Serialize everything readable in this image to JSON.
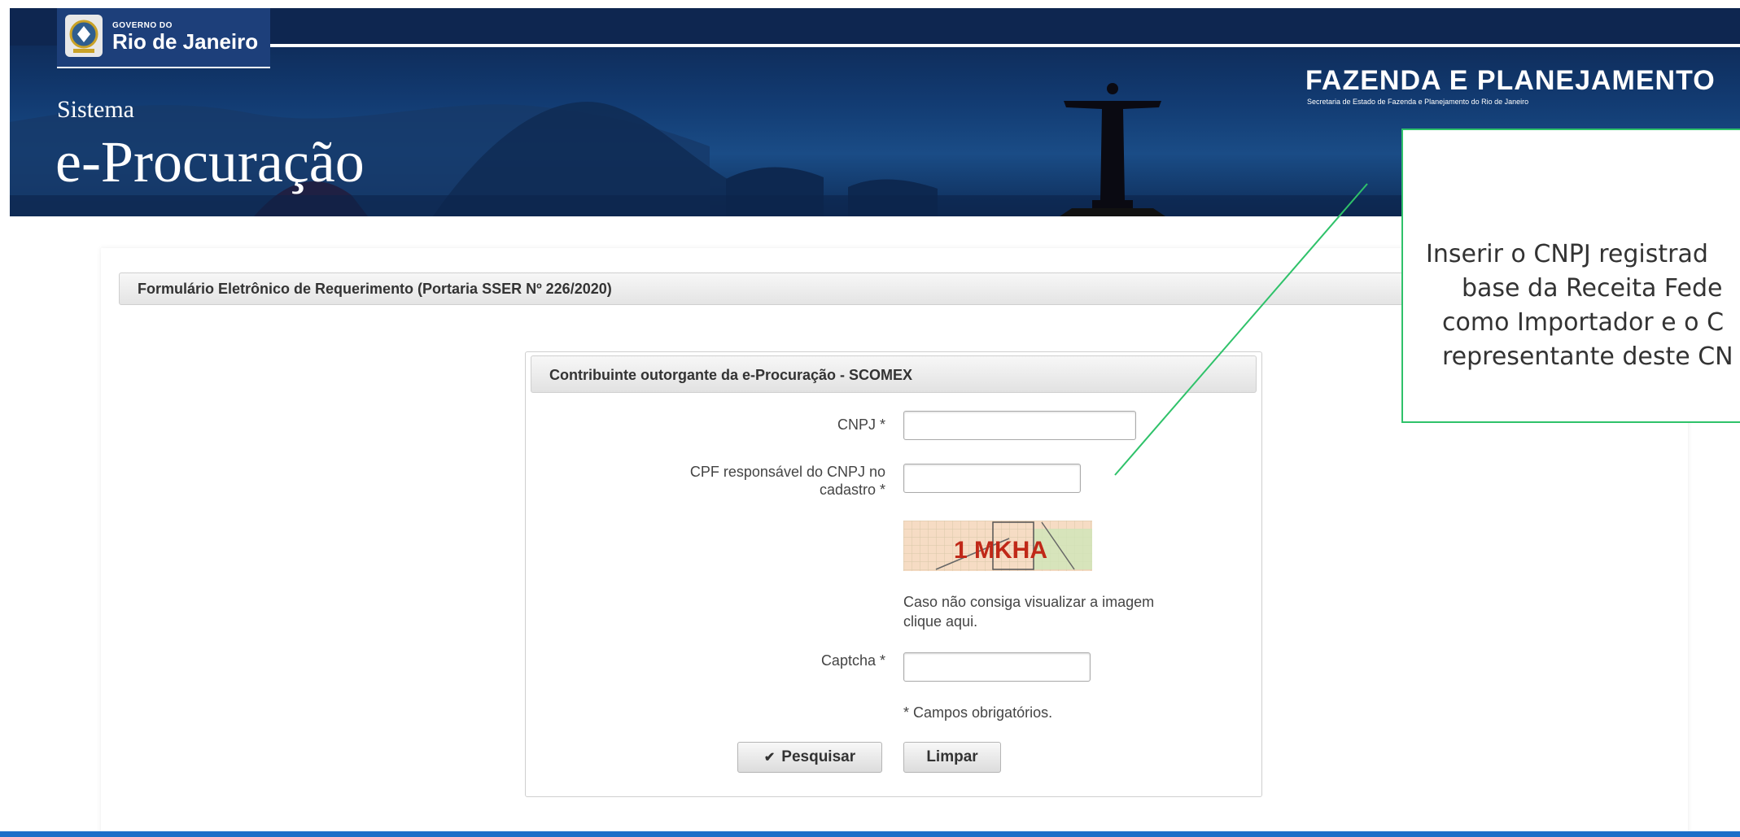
{
  "header": {
    "gov_small": "GOVERNO DO",
    "gov_name": "Rio de Janeiro",
    "system_label": "Sistema",
    "system_name": "e-Procuração",
    "org_title": "FAZENDA E PLANEJAMENTO",
    "org_subtitle": "Secretaria de Estado de Fazenda e Planejamento do Rio de Janeiro"
  },
  "page": {
    "outer_title": "Formulário Eletrônico de Requerimento (Portaria SSER Nº 226/2020)"
  },
  "form": {
    "title": "Contribuinte outorgante da e-Procuração - SCOMEX",
    "cnpj_label": "CNPJ *",
    "cnpj_value": "",
    "cpf_label_line1": "CPF responsável do CNPJ no",
    "cpf_label_line2": "cadastro *",
    "cpf_value": "",
    "captcha_text": "1 MKHA",
    "captcha_hint_line1": "Caso não consiga visualizar a imagem",
    "captcha_hint_line2": "clique aqui.",
    "captcha_label": "Captcha *",
    "captcha_value": "",
    "required_note": "* Campos obrigatórios.",
    "search_button": "Pesquisar",
    "clear_button": "Limpar"
  },
  "callout": {
    "line1": "Inserir o CNPJ registrad",
    "line2": "base da Receita Fede",
    "line3": "como Importador e o C",
    "line4": "representante deste CN",
    "border_color": "#2fc26a"
  },
  "colors": {
    "header_dark": "#0e2650",
    "bottom_bar": "#1d6fc8"
  }
}
